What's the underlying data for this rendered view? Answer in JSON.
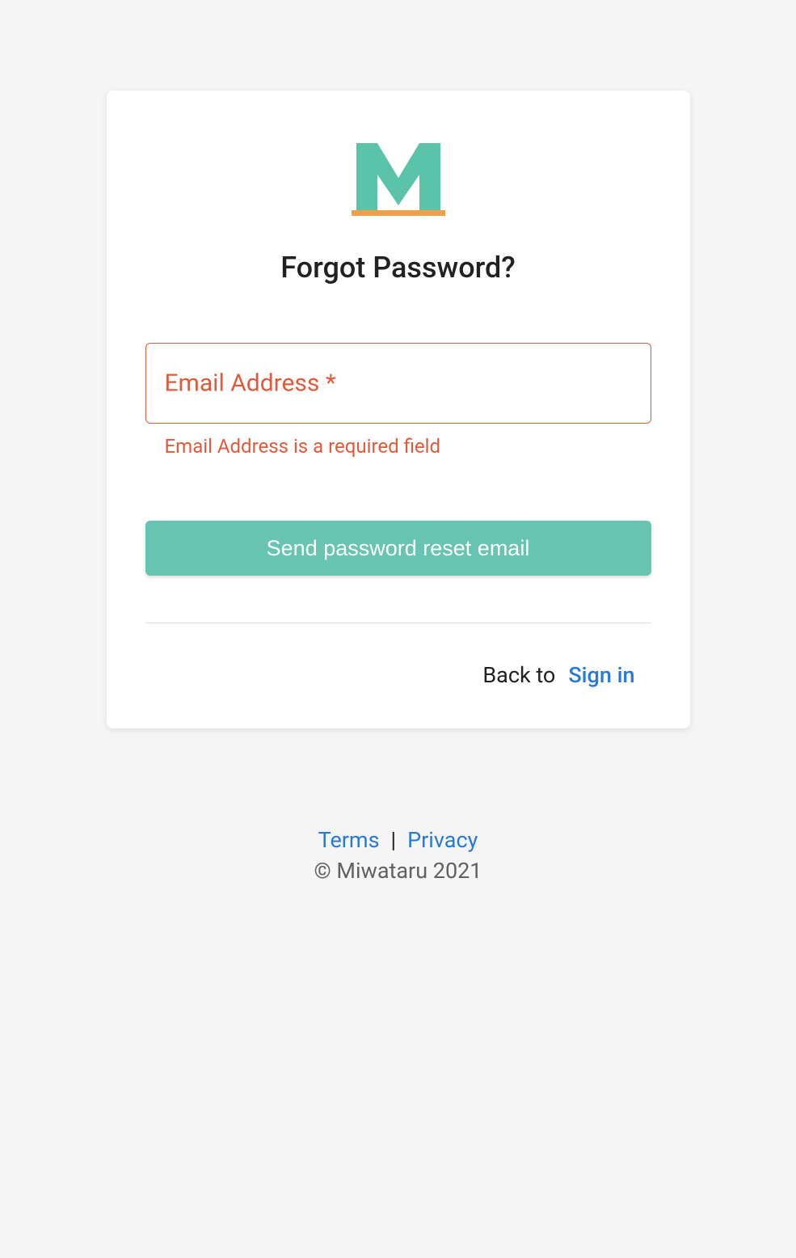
{
  "card": {
    "title": "Forgot Password?",
    "email_field": {
      "label": "Email Address *",
      "value": "",
      "helper": "Email Address is a required field"
    },
    "submit_label": "Send password reset email",
    "back_text": "Back to",
    "signin_label": "Sign in"
  },
  "footer": {
    "terms_label": "Terms",
    "separator": "|",
    "privacy_label": "Privacy",
    "copyright": "© Miwataru 2021"
  },
  "colors": {
    "error": "#e05a3b",
    "primary_button": "#67c4b0",
    "link": "#2979d6",
    "logo_teal": "#5bc3a9",
    "logo_orange": "#f0a04c"
  }
}
